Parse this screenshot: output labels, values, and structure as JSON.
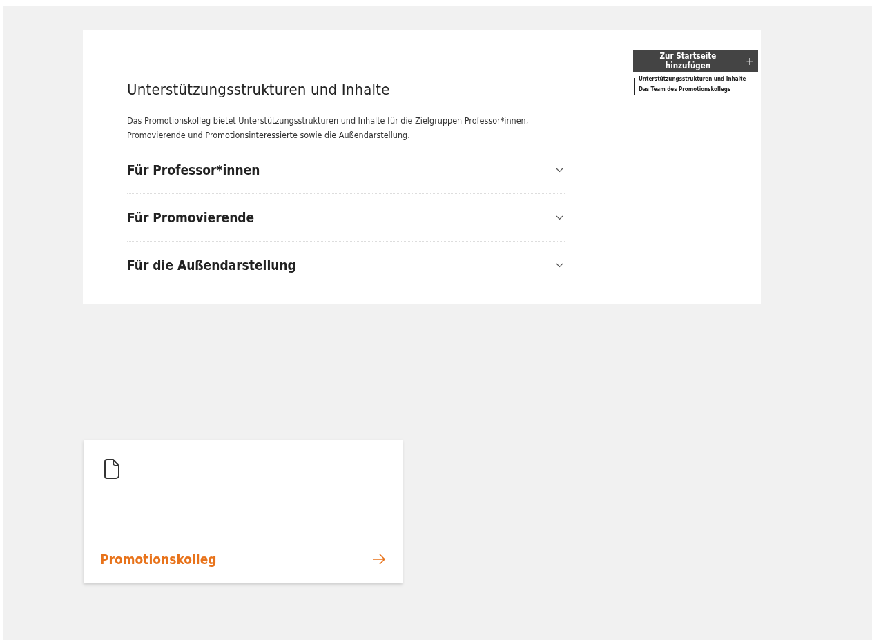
{
  "section": {
    "title": "Unterstützungsstrukturen und Inhalte",
    "intro": "Das Promotionskolleg bietet Unterstützungsstrukturen und Inhalte für die Zielgruppen Professor*innen, Promovierende und Promotionsinteressierte sowie die Außendarstellung.",
    "accordion": [
      {
        "label": "Für Professor*innen",
        "expanded": false
      },
      {
        "label": "Für Promovierende",
        "expanded": false
      },
      {
        "label": "Für die Außendarstellung",
        "expanded": false
      }
    ]
  },
  "sidebar": {
    "add_button": {
      "label": "Zur Startseite hinzufügen",
      "icon": "+"
    },
    "toc": [
      "Unterstützungsstrukturen und Inhalte",
      "Das Team des Promotionskollegs"
    ]
  },
  "card": {
    "title": "Promotionskolleg"
  }
}
